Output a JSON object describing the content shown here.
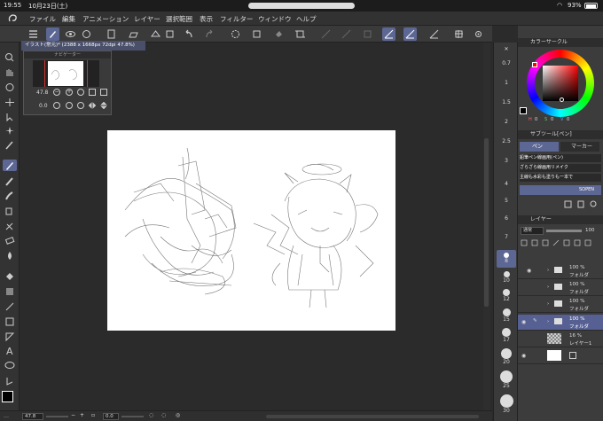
{
  "status": {
    "time": "19:55",
    "date": "10月23日(土)",
    "battery": "93%"
  },
  "menu": {
    "items": [
      "ファイル",
      "編集",
      "アニメーション",
      "レイヤー",
      "選択範囲",
      "表示",
      "フィルター",
      "ウィンドウ",
      "ヘルプ"
    ]
  },
  "document": {
    "tab_label": "イラスト(常元)* (2388 x 1668px 72dpi 47.8%)"
  },
  "navigator": {
    "title": "ナビゲーター",
    "zoom": "47.8",
    "rotation": "0.0"
  },
  "bottom": {
    "zoom": "47.8",
    "angle": "0.0"
  },
  "size_palette": {
    "values": [
      "0.7",
      "1",
      "1.5",
      "2",
      "2.5",
      "3",
      "4",
      "5",
      "6",
      "7",
      "8",
      "10",
      "12",
      "15",
      "17",
      "20",
      "25",
      "30"
    ],
    "selected": "8"
  },
  "color_wheel": {
    "title": "カラーサークル",
    "h": "0",
    "s": "0",
    "v": "0"
  },
  "sub_tool": {
    "title": "サブツール[ペン]",
    "tab_pen": "ペン",
    "tab_marker": "マーカー",
    "brushes": [
      "鉛筆ペン線画用(ペン)",
      "ざらざら線画用リメイク",
      "主線も水彩も塗りも一本で",
      "SOPEN"
    ]
  },
  "layers": {
    "title": "レイヤー",
    "blend_mode": "通常",
    "opacity": "100",
    "items": [
      {
        "percent": "100 %",
        "name": "フォルダ"
      },
      {
        "percent": "100 %",
        "name": "フォルダ"
      },
      {
        "percent": "100 %",
        "name": "フォルダ"
      },
      {
        "percent": "100 %",
        "name": "フォルダ"
      },
      {
        "percent": "16 %",
        "name": "レイヤー1"
      },
      {
        "percent": "",
        "name": ""
      }
    ]
  },
  "colors": {
    "accent": "#5d6794",
    "panel": "#3c3c3c",
    "paper": "#ffffff"
  }
}
